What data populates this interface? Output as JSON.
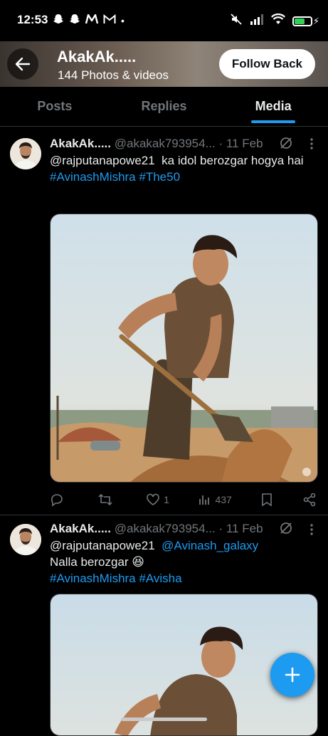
{
  "status_bar": {
    "time": "12:53",
    "indicator_icons": [
      "snapchat-icon",
      "snapchat-icon",
      "medium-icon",
      "gmail-icon"
    ],
    "dot": "•"
  },
  "header": {
    "title": "AkakAk.....",
    "subtitle": "144 Photos & videos",
    "follow_label": "Follow Back"
  },
  "tabs": [
    {
      "label": "Posts",
      "active": false
    },
    {
      "label": "Replies",
      "active": false
    },
    {
      "label": "Media",
      "active": true
    }
  ],
  "colors": {
    "accent": "#1d9bf0",
    "background": "#000000",
    "muted": "#71767b"
  },
  "posts": [
    {
      "display_name": "AkakAk.....",
      "handle": "@akakak793954...",
      "date": "· 11 Feb",
      "text_mention": "@rajputanapowe21",
      "text_body": "ka idol berozgar hogya hai",
      "hashtags": [
        "#AvinashMishra",
        "#The50"
      ],
      "replies": "",
      "reposts": "",
      "likes": "1",
      "views": "437"
    },
    {
      "display_name": "AkakAk.....",
      "handle": "@akakak793954...",
      "date": "· 11 Feb",
      "text_mention": "@rajputanapowe21",
      "text_mention2": "@Avinash_galaxy",
      "text_body": "Nalla berozgar 😆",
      "hashtags": [
        "#AvinashMishra",
        "#Avisha"
      ]
    }
  ]
}
